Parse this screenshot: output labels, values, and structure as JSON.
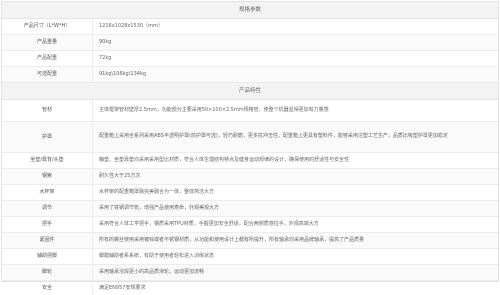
{
  "spec": {
    "title": "规格参数",
    "rows": [
      {
        "label": "产品尺寸（L*W*H）",
        "value": "1216x1028x1530（mm）"
      },
      {
        "label": "产品重量",
        "value": "90kg"
      },
      {
        "label": "产品配重",
        "value": "72kg"
      },
      {
        "label": "可选配重",
        "value": "91kg\\106kg\\134kg"
      }
    ]
  },
  "features": {
    "title": "产品特性",
    "rows": [
      {
        "label": "管材",
        "value": "主体框架管材壁厚2.5mm，功能部分主要采用50×100×2.5mm规格管，使整个机器显得更加有力量感"
      },
      {
        "label": "护罩",
        "value": "配重箱上采用全系列采用ABS半透明护罩(前护罩可选)，轻巧耐磨，更多抗冲击性，配重箱上更具有塑料件，能够采用注塑工艺生产，品质比吸塑护罩更加稳定"
      },
      {
        "label": "坐垫/靠背/头垫",
        "value": "胸垫、坐垫靠垫均采用采用型比材质，符合人体生理结构特点及健身运动规律的设计，确保使用的舒适性与安全性"
      },
      {
        "label": "钢索",
        "value": "耐久性大于25万次"
      },
      {
        "label": "水杯架",
        "value": "水杯架的配重箱罩融完美融合为一体，整体简洁大方"
      },
      {
        "label": "调节",
        "value": "采用了铁钢调节管，增强产品使用寿命，外观美观大方"
      },
      {
        "label": "把手",
        "value": "采用符合人体工学把手，钢质采用TPU材质，手握更加安全舒适，配合两侧质感拉手，外观高端大方"
      },
      {
        "label": "紧固件",
        "value": "所有的螺丝使用采用镀锌或者不锈钢材质，从功能和使用设计上都有所提升，所有轴承均采用品牌轴承，提高了产品质量"
      },
      {
        "label": "辅助把脚",
        "value": "脚踏辅助者系系统，有助于使用者轻松进入训练状态"
      },
      {
        "label": "脚轮",
        "value": "采用轴承溶焊更小的高品质滑轮，运动更加流畅"
      },
      {
        "label": "安全",
        "value": "满足EN957安规要求"
      }
    ]
  }
}
